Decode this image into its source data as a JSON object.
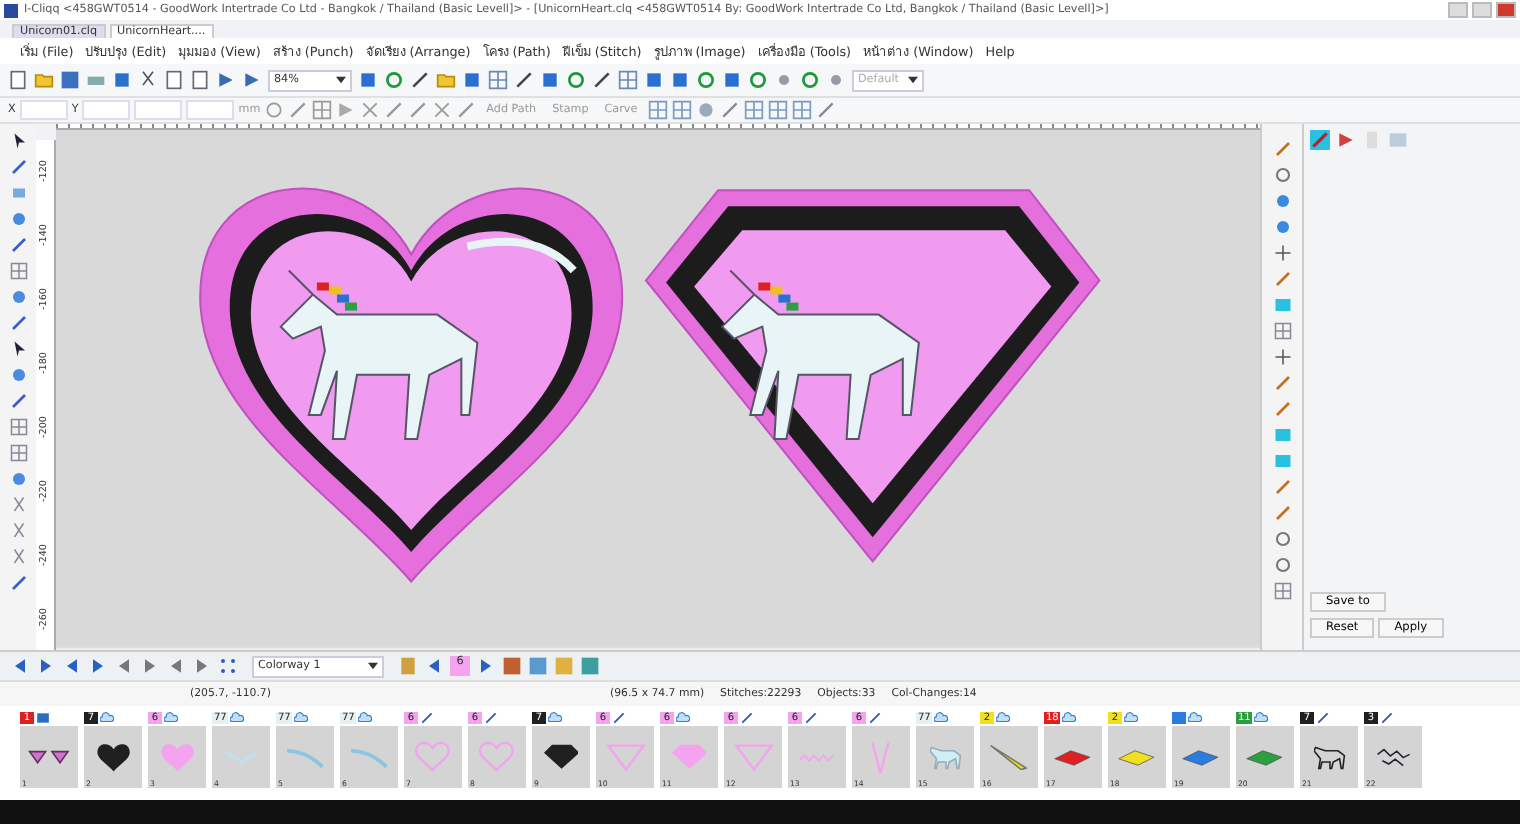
{
  "window": {
    "title": "I-Cliqq <458GWT0514 - GoodWork Intertrade Co Ltd - Bangkok / Thailand (Basic Levell]> - [UnicornHeart.clq <458GWT0514 By: GoodWork Intertrade Co Ltd, Bangkok / Thailand (Basic Levell]>]"
  },
  "doc_tabs": [
    {
      "label": "Unicorn01.clq",
      "selected": false
    },
    {
      "label": "UnicornHeart....",
      "selected": true
    }
  ],
  "menu": [
    "เริ่ม (File)",
    "ปรับปรุง (Edit)",
    "มุมมอง (View)",
    "สร้าง (Punch)",
    "จัดเรียง (Arrange)",
    "โครง (Path)",
    "ฝีเข็ม (Stitch)",
    "รูปภาพ (Image)",
    "เครื่องมือ (Tools)",
    "หน้าต่าง (Window)",
    "Help"
  ],
  "toolbar": {
    "zoom": "84%",
    "style": "Default"
  },
  "properties_bar": {
    "x_label": "X",
    "y_label": "Y",
    "unit": "mm",
    "actions": [
      "Add Path",
      "Stamp",
      "Carve"
    ]
  },
  "ruler": {
    "vertical": [
      "-120",
      "-140",
      "-160",
      "-180",
      "-200",
      "-220",
      "-240",
      "-260"
    ]
  },
  "side_panel": {
    "buttons": [
      "Save to",
      "Reset",
      "Apply"
    ]
  },
  "navigator": {
    "colorway": "Colorway 1",
    "color_number": "6",
    "color": "#f4a3ee"
  },
  "status_bar": {
    "cursor": "(205.7, -110.7)",
    "size": "(96.5 x 74.7 mm)",
    "stitches": "Stitches:22293",
    "objects": "Objects:33",
    "color_changes": "Col-Changes:14"
  },
  "objects": [
    {
      "index": "1",
      "badge": "1",
      "color": "#e02020",
      "icon": {
        "kind": "picture"
      },
      "kind": "gems"
    },
    {
      "index": "2",
      "badge": "7",
      "color": "#202020",
      "icon": {
        "kind": "fill"
      },
      "kind": "heart"
    },
    {
      "index": "3",
      "badge": "6",
      "color": "#f4a3ee",
      "icon": {
        "kind": "fill"
      },
      "kind": "heart"
    },
    {
      "index": "4",
      "badge": "77",
      "color": "#e6f0f2",
      "icon": {
        "kind": "fill"
      },
      "kind": "chevron"
    },
    {
      "index": "5",
      "badge": "77",
      "color": "#e6f0f2",
      "icon": {
        "kind": "fill"
      },
      "kind": "arc"
    },
    {
      "index": "6",
      "badge": "77",
      "color": "#e6f0f2",
      "icon": {
        "kind": "fill"
      },
      "kind": "arc"
    },
    {
      "index": "7",
      "badge": "6",
      "color": "#f4a3ee",
      "icon": {
        "kind": "outline"
      },
      "kind": "heart-outline"
    },
    {
      "index": "8",
      "badge": "6",
      "color": "#f4a3ee",
      "icon": {
        "kind": "outline"
      },
      "kind": "heart-outline"
    },
    {
      "index": "9",
      "badge": "7",
      "color": "#202020",
      "icon": {
        "kind": "fill"
      },
      "kind": "diamond"
    },
    {
      "index": "10",
      "badge": "6",
      "color": "#f4a3ee",
      "icon": {
        "kind": "outline"
      },
      "kind": "triangle-outline"
    },
    {
      "index": "11",
      "badge": "6",
      "color": "#f4a3ee",
      "icon": {
        "kind": "fill"
      },
      "kind": "diamond"
    },
    {
      "index": "12",
      "badge": "6",
      "color": "#f4a3ee",
      "icon": {
        "kind": "outline"
      },
      "kind": "triangle-outline"
    },
    {
      "index": "13",
      "badge": "6",
      "color": "#f4a3ee",
      "icon": {
        "kind": "outline"
      },
      "kind": "zigzag"
    },
    {
      "index": "14",
      "badge": "6",
      "color": "#f4a3ee",
      "icon": {
        "kind": "outline"
      },
      "kind": "v"
    },
    {
      "index": "15",
      "badge": "77",
      "color": "#e6f0f2",
      "icon": {
        "kind": "fill"
      },
      "kind": "unicorn"
    },
    {
      "index": "16",
      "badge": "2",
      "color": "#f0e020",
      "icon": {
        "kind": "fill"
      },
      "kind": "strip"
    },
    {
      "index": "17",
      "badge": "18",
      "color": "#e02020",
      "icon": {
        "kind": "fill"
      },
      "kind": "plane"
    },
    {
      "index": "18",
      "badge": "2",
      "color": "#f0e020",
      "icon": {
        "kind": "fill"
      },
      "kind": "plane"
    },
    {
      "index": "19",
      "color": "#2a7de0",
      "icon": {
        "kind": "fill"
      },
      "kind": "plane"
    },
    {
      "index": "20",
      "badge": "11",
      "color": "#2aa040",
      "icon": {
        "kind": "fill"
      },
      "kind": "plane"
    },
    {
      "index": "21",
      "badge": "7",
      "color": "#202020",
      "icon": {
        "kind": "outline"
      },
      "kind": "unicorn-outline"
    },
    {
      "index": "22",
      "badge": "3",
      "color": "#202020",
      "icon": {
        "kind": "outline"
      },
      "kind": "unicorn-detail"
    }
  ]
}
